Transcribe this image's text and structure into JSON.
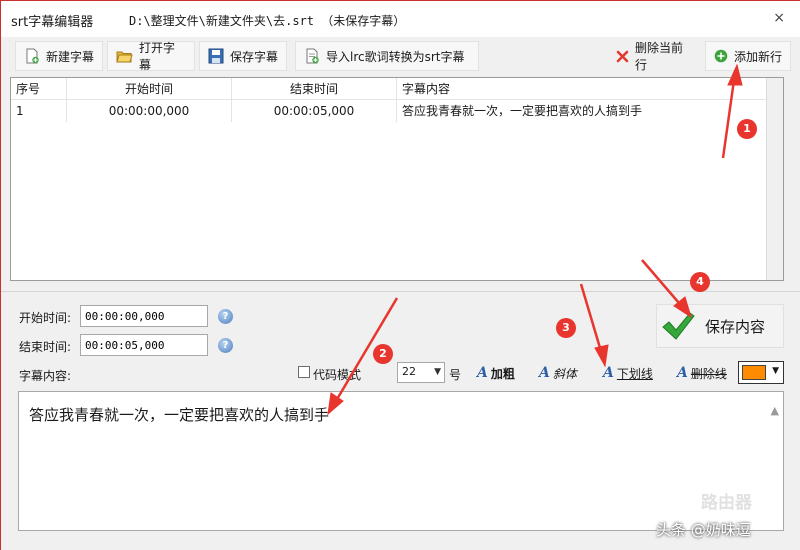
{
  "window": {
    "app_title": "srt字幕编辑器",
    "file_path": "D:\\整理文件\\新建文件夹\\去.srt （未保存字幕）",
    "close_glyph": "×"
  },
  "toolbar": {
    "new_label": "新建字幕",
    "open_label": "打开字幕",
    "save_label": "保存字幕",
    "import_label": "导入lrc歌词转换为srt字幕",
    "delete_row_label": "删除当前行",
    "add_row_label": "添加新行"
  },
  "table": {
    "columns": [
      "序号",
      "开始时间",
      "结束时间",
      "字幕内容"
    ],
    "rows": [
      {
        "index": "1",
        "start": "00:00:00,000",
        "end": "00:00:05,000",
        "content": "答应我青春就一次，一定要把喜欢的人搞到手"
      }
    ]
  },
  "editor": {
    "start_label": "开始时间:",
    "start_value": "00:00:00,000",
    "end_label": "结束时间:",
    "end_value": "00:00:05,000",
    "content_label": "字幕内容:",
    "code_mode_label": "代码模式",
    "font_size_value": "22",
    "font_size_unit": "号",
    "bold_label": "加粗",
    "italic_label": "斜体",
    "underline_label": "下划线",
    "strike_label": "删除线",
    "save_content_label": "保存内容",
    "content_text": "答应我青春就一次，一定要把喜欢的人搞到手",
    "help_glyph": "?"
  },
  "annotations": {
    "badge_1": "1",
    "badge_2": "2",
    "badge_3": "3",
    "badge_4": "4"
  },
  "watermark": {
    "credit": "头条 @奶味逗",
    "logo_text": "路由器"
  },
  "colors": {
    "text_color_swatch": "#ff8c00",
    "annotation_red": "#e8352e"
  }
}
